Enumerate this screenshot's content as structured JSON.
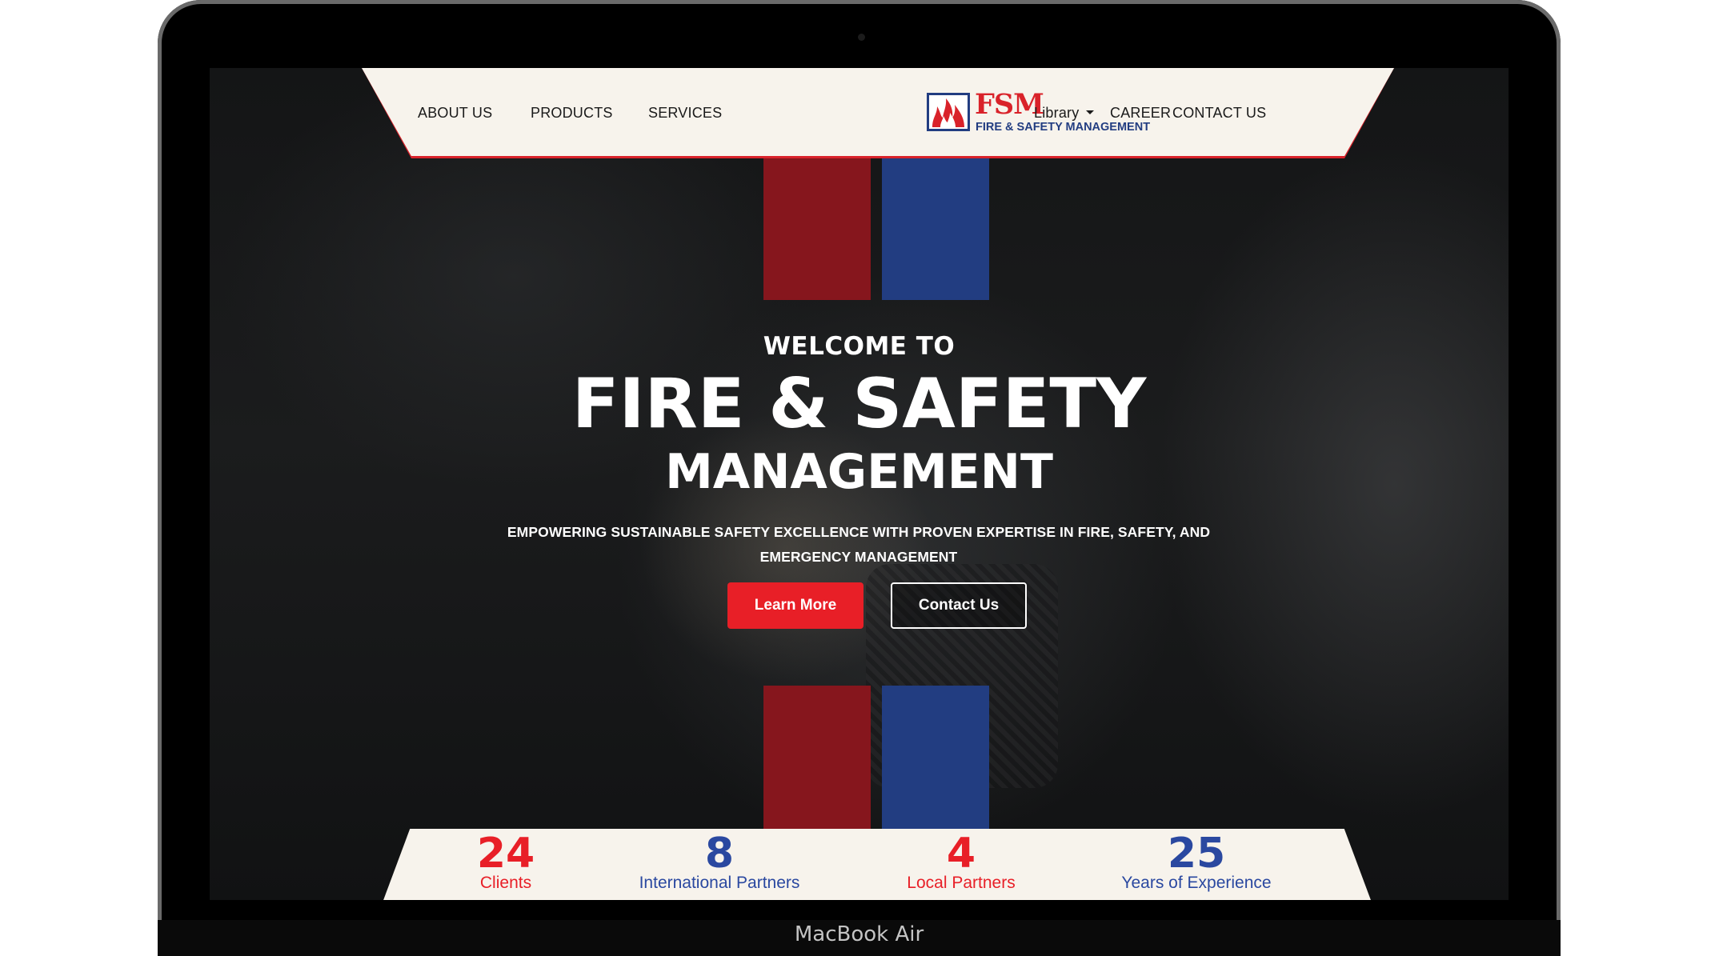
{
  "device": {
    "label": "MacBook Air"
  },
  "nav": {
    "left_links": [
      "ABOUT US",
      "PRODUCTS",
      "SERVICES"
    ],
    "right_links": [
      "Library",
      "CAREER",
      "CONTACT US"
    ],
    "logo": {
      "acronym": "FSM",
      "subtitle": "FIRE & SAFETY MANAGEMENT"
    }
  },
  "hero": {
    "welcome": "WELCOME TO",
    "title_line1": "FIRE & SAFETY",
    "title_line2": "MANAGEMENT",
    "tagline": "EMPOWERING SUSTAINABLE SAFETY EXCELLENCE WITH PROVEN EXPERTISE IN FIRE, SAFETY, AND EMERGENCY MANAGEMENT",
    "learn_more": "Learn More",
    "contact_us": "Contact Us"
  },
  "stats": [
    {
      "value": "24",
      "label": "Clients",
      "color": "#e81f27"
    },
    {
      "value": "8",
      "label": "International Partners",
      "color": "#2a48a0"
    },
    {
      "value": "4",
      "label": "Local Partners",
      "color": "#e81f27"
    },
    {
      "value": "25",
      "label": "Years of Experience",
      "color": "#2a48a0"
    }
  ],
  "colors": {
    "brand_red": "#e81f27",
    "brand_blue": "#223d81",
    "nav_bg": "#f7f3ec"
  },
  "icons": {
    "library_dropdown": "caret-down-icon",
    "logo_mark": "flame-icon"
  }
}
